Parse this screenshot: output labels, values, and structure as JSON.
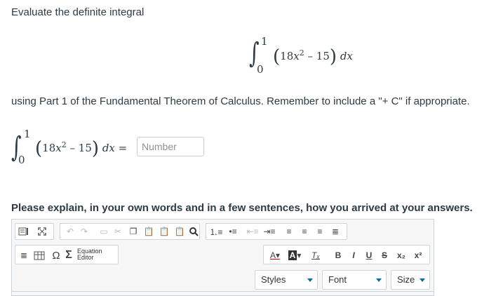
{
  "question": {
    "prompt": "Evaluate the definite integral",
    "integral": {
      "lower": "0",
      "upper": "1",
      "coefficient": "18",
      "variable": "x",
      "exponent": "2",
      "minus": "–",
      "constant": "15",
      "differential": "dx",
      "integral_sign": "∫"
    },
    "ftc_instruction": "using Part 1 of the Fundamental Theorem of Calculus. Remember to include a \"+ C\" if appropriate.",
    "answer_equals": "=",
    "answer_placeholder": "Number",
    "answer_value": ""
  },
  "explain": {
    "prompt": "Please explain, in your own words and in a few sentences, how you arrived at your answers."
  },
  "editor": {
    "equation_editor_label_1": "Equation",
    "equation_editor_label_2": "Editor",
    "omega": "Ω",
    "sigma": "Σ",
    "styles": "Styles",
    "font": "Font",
    "size": "Size",
    "bold": "B",
    "italic": "I",
    "underline": "U",
    "strike": "S",
    "subscript": "x₂",
    "superscript": "x²",
    "accent": "#0770a3"
  }
}
